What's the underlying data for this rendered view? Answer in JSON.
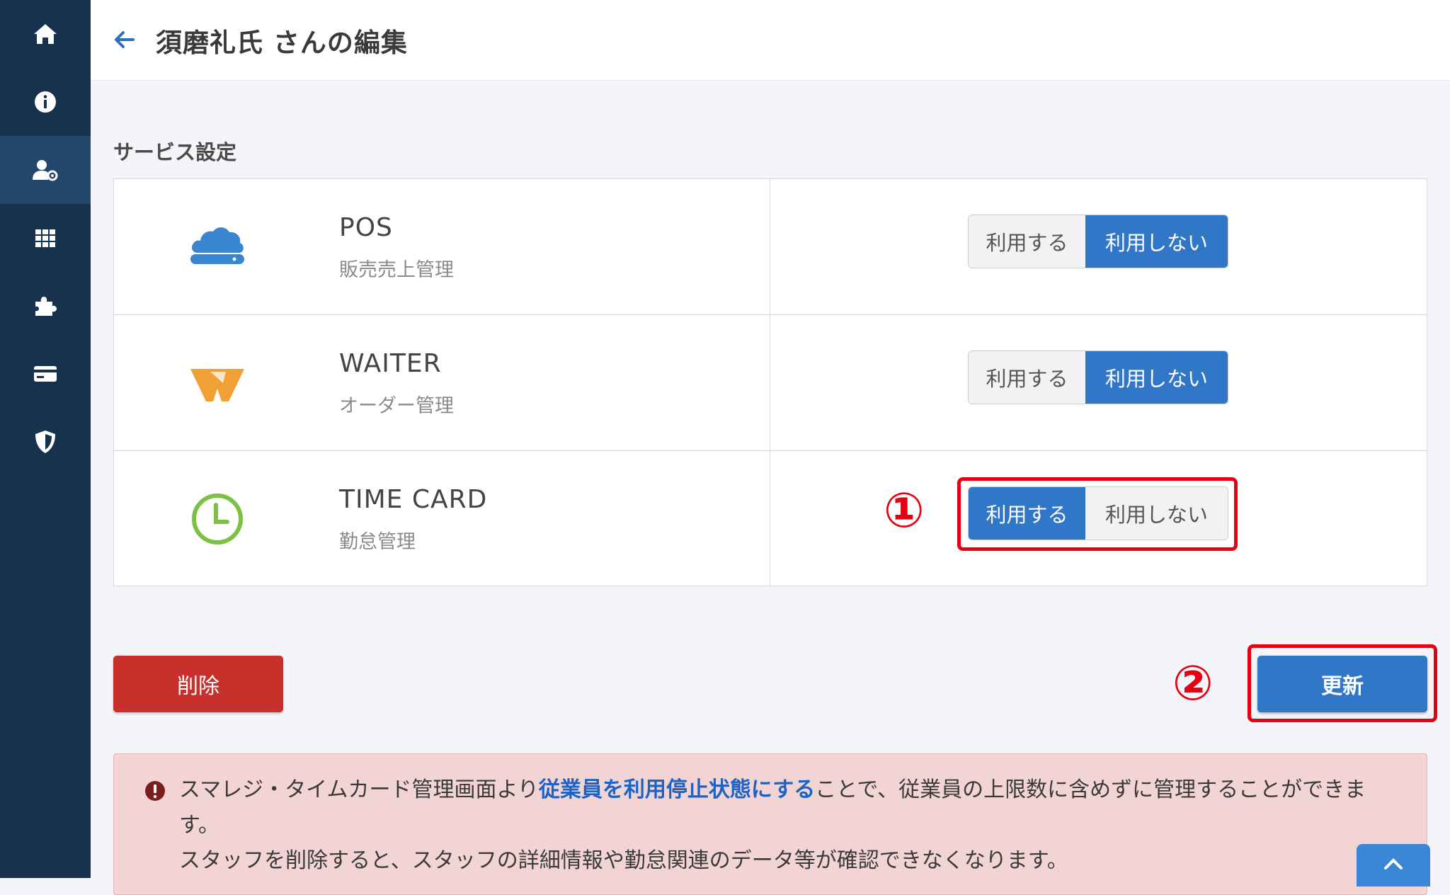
{
  "header": {
    "title": "須磨礼氏 さんの編集"
  },
  "sidebar": {
    "items": [
      {
        "icon": "home-icon"
      },
      {
        "icon": "info-icon"
      },
      {
        "icon": "user-settings-icon",
        "active": true
      },
      {
        "icon": "grid-icon"
      },
      {
        "icon": "puzzle-icon"
      },
      {
        "icon": "credit-card-icon"
      },
      {
        "icon": "shield-icon"
      }
    ]
  },
  "section_title": "サービス設定",
  "services": [
    {
      "name": "POS",
      "desc": "販売売上管理",
      "on_label": "利用する",
      "off_label": "利用しない",
      "selected": "off",
      "icon": "pos-cloud-icon",
      "color": "#3a85cf"
    },
    {
      "name": "WAITER",
      "desc": "オーダー管理",
      "on_label": "利用する",
      "off_label": "利用しない",
      "selected": "off",
      "icon": "waiter-logo-icon",
      "color": "#f0a035"
    },
    {
      "name": "TIME CARD",
      "desc": "勤怠管理",
      "on_label": "利用する",
      "off_label": "利用しない",
      "selected": "on",
      "icon": "clock-icon",
      "color": "#7cc142"
    }
  ],
  "markers": {
    "one": "①",
    "two": "②"
  },
  "buttons": {
    "delete": "削除",
    "update": "更新"
  },
  "alert": {
    "part1": "スマレジ・タイムカード管理画面より",
    "link": "従業員を利用停止状態にする",
    "part2": "ことで、従業員の上限数に含めずに管理することができます。",
    "line2": "スタッフを削除すると、スタッフの詳細情報や勤怠関連のデータ等が確認できなくなります。"
  },
  "colors": {
    "sidebar_bg": "#17314f",
    "primary": "#3177c8",
    "danger": "#c8302c",
    "highlight": "#e60012",
    "alert_bg": "#f2d4d4"
  }
}
